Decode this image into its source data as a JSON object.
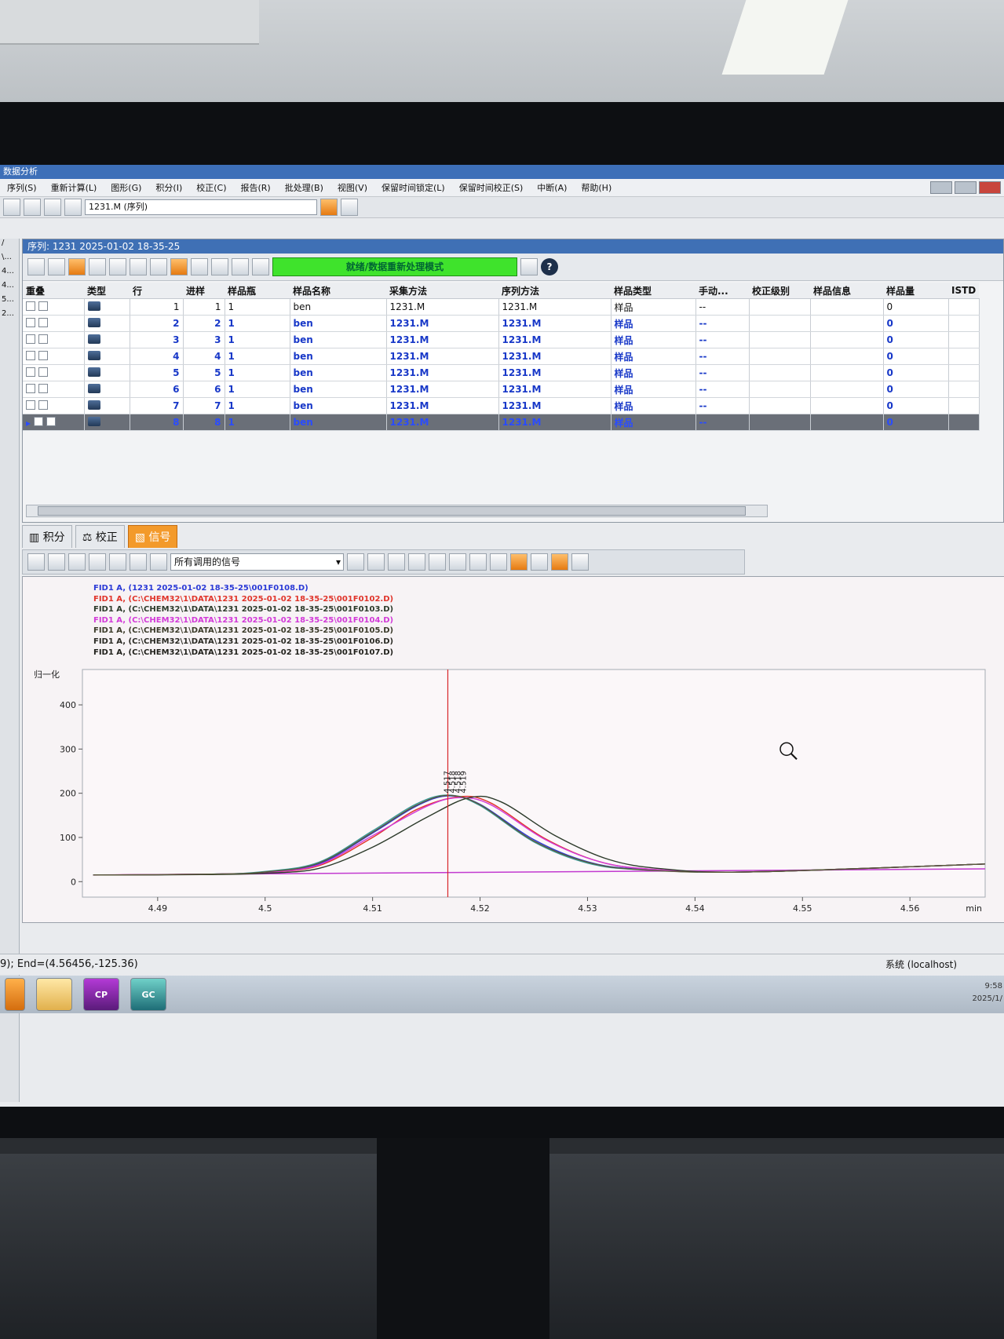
{
  "app": {
    "title": "数据分析",
    "menu": [
      "序列(S)",
      "重新计算(L)",
      "图形(G)",
      "积分(I)",
      "校正(C)",
      "报告(R)",
      "批处理(B)",
      "视图(V)",
      "保留时间锁定(L)",
      "保留时间校正(S)",
      "中断(A)",
      "帮助(H)"
    ],
    "method_combo": "1231.M (序列)"
  },
  "sequence": {
    "title": "序列:  1231 2025-01-02 18-35-25",
    "status": "就绪/数据重新处理模式",
    "columns": [
      "重叠",
      "类型",
      "行",
      "进样",
      "样品瓶",
      "样品名称",
      "采集方法",
      "序列方法",
      "样品类型",
      "手动...",
      "校正级别",
      "样品信息",
      "样品量",
      "ISTD"
    ],
    "rows": [
      {
        "line": "1",
        "inj": "1",
        "vial": "1",
        "name": "ben",
        "acq": "1231.M",
        "seqm": "1231.M",
        "stype": "样品",
        "manual": "--",
        "amount": "0"
      },
      {
        "line": "2",
        "inj": "2",
        "vial": "1",
        "name": "ben",
        "acq": "1231.M",
        "seqm": "1231.M",
        "stype": "样品",
        "manual": "--",
        "amount": "0"
      },
      {
        "line": "3",
        "inj": "3",
        "vial": "1",
        "name": "ben",
        "acq": "1231.M",
        "seqm": "1231.M",
        "stype": "样品",
        "manual": "--",
        "amount": "0"
      },
      {
        "line": "4",
        "inj": "4",
        "vial": "1",
        "name": "ben",
        "acq": "1231.M",
        "seqm": "1231.M",
        "stype": "样品",
        "manual": "--",
        "amount": "0"
      },
      {
        "line": "5",
        "inj": "5",
        "vial": "1",
        "name": "ben",
        "acq": "1231.M",
        "seqm": "1231.M",
        "stype": "样品",
        "manual": "--",
        "amount": "0"
      },
      {
        "line": "6",
        "inj": "6",
        "vial": "1",
        "name": "ben",
        "acq": "1231.M",
        "seqm": "1231.M",
        "stype": "样品",
        "manual": "--",
        "amount": "0"
      },
      {
        "line": "7",
        "inj": "7",
        "vial": "1",
        "name": "ben",
        "acq": "1231.M",
        "seqm": "1231.M",
        "stype": "样品",
        "manual": "--",
        "amount": "0"
      },
      {
        "line": "8",
        "inj": "8",
        "vial": "1",
        "name": "ben",
        "acq": "1231.M",
        "seqm": "1231.M",
        "stype": "样品",
        "manual": "--",
        "amount": "0"
      }
    ]
  },
  "tabs": [
    "积分",
    "校正",
    "信号"
  ],
  "signal_combo": "所有调用的信号",
  "legend": [
    {
      "text": "FID1 A,  (1231 2025-01-02 18-35-25\\001F0108.D)",
      "color": "#2b3ad6"
    },
    {
      "text": "FID1 A,  (C:\\CHEM32\\1\\DATA\\1231 2025-01-02 18-35-25\\001F0102.D)",
      "color": "#e0342a"
    },
    {
      "text": "FID1 A,  (C:\\CHEM32\\1\\DATA\\1231 2025-01-02 18-35-25\\001F0103.D)",
      "color": "#2c3a2a"
    },
    {
      "text": "FID1 A,  (C:\\CHEM32\\1\\DATA\\1231 2025-01-02 18-35-25\\001F0104.D)",
      "color": "#d23ad8"
    },
    {
      "text": "FID1 A,  (C:\\CHEM32\\1\\DATA\\1231 2025-01-02 18-35-25\\001F0105.D)",
      "color": "#3b3b2a"
    },
    {
      "text": "FID1 A,  (C:\\CHEM32\\1\\DATA\\1231 2025-01-02 18-35-25\\001F0106.D)",
      "color": "#2a2a24"
    },
    {
      "text": "FID1 A,  (C:\\CHEM32\\1\\DATA\\1231 2025-01-02 18-35-25\\001F0107.D)",
      "color": "#1f1f1a"
    }
  ],
  "chart_data": {
    "type": "line",
    "ylabel": "归一化",
    "xlabel": "min",
    "xlim": [
      4.483,
      4.567
    ],
    "ylim": [
      -35,
      480
    ],
    "xticks": [
      "4.49",
      "4.5",
      "4.51",
      "4.52",
      "4.53",
      "4.54",
      "4.55",
      "4.56"
    ],
    "yticks": [
      "0",
      "100",
      "200",
      "300",
      "400"
    ],
    "cursor_x": 4.517,
    "peak_labels": [
      "4.517",
      "4.518",
      "4.518",
      "4.519"
    ],
    "series": [
      {
        "color": "#2b3ad6",
        "values": [
          [
            4.484,
            15
          ],
          [
            4.495,
            17
          ],
          [
            4.5,
            22
          ],
          [
            4.505,
            40
          ],
          [
            4.51,
            110
          ],
          [
            4.514,
            170
          ],
          [
            4.517,
            194
          ],
          [
            4.52,
            175
          ],
          [
            4.525,
            95
          ],
          [
            4.53,
            45
          ],
          [
            4.535,
            28
          ],
          [
            4.545,
            22
          ],
          [
            4.567,
            40
          ]
        ]
      },
      {
        "color": "#e0342a",
        "values": [
          [
            4.484,
            15
          ],
          [
            4.495,
            17
          ],
          [
            4.5,
            21
          ],
          [
            4.505,
            36
          ],
          [
            4.51,
            100
          ],
          [
            4.514,
            162
          ],
          [
            4.518,
            192
          ],
          [
            4.521,
            178
          ],
          [
            4.526,
            98
          ],
          [
            4.531,
            46
          ],
          [
            4.536,
            28
          ],
          [
            4.545,
            22
          ],
          [
            4.567,
            40
          ]
        ]
      },
      {
        "color": "#3a9a9a",
        "values": [
          [
            4.484,
            15
          ],
          [
            4.495,
            17
          ],
          [
            4.5,
            23
          ],
          [
            4.505,
            44
          ],
          [
            4.51,
            115
          ],
          [
            4.514,
            175
          ],
          [
            4.517,
            196
          ],
          [
            4.52,
            172
          ],
          [
            4.525,
            90
          ],
          [
            4.53,
            42
          ],
          [
            4.535,
            27
          ],
          [
            4.545,
            22
          ],
          [
            4.567,
            40
          ]
        ]
      },
      {
        "color": "#d23ad8",
        "values": [
          [
            4.484,
            15
          ],
          [
            4.495,
            17
          ],
          [
            4.5,
            21
          ],
          [
            4.505,
            38
          ],
          [
            4.51,
            104
          ],
          [
            4.515,
            170
          ],
          [
            4.518,
            190
          ],
          [
            4.521,
            174
          ],
          [
            4.526,
            96
          ],
          [
            4.531,
            46
          ],
          [
            4.536,
            28
          ],
          [
            4.545,
            22
          ],
          [
            4.567,
            40
          ]
        ]
      },
      {
        "color": "#2c3a2a",
        "values": [
          [
            4.484,
            15
          ],
          [
            4.495,
            16
          ],
          [
            4.5,
            19
          ],
          [
            4.505,
            30
          ],
          [
            4.51,
            78
          ],
          [
            4.515,
            145
          ],
          [
            4.519,
            190
          ],
          [
            4.522,
            180
          ],
          [
            4.527,
            104
          ],
          [
            4.532,
            50
          ],
          [
            4.537,
            29
          ],
          [
            4.545,
            22
          ],
          [
            4.567,
            40
          ]
        ]
      },
      {
        "color": "#5a5a3a",
        "values": [
          [
            4.484,
            15
          ],
          [
            4.495,
            17
          ],
          [
            4.5,
            22
          ],
          [
            4.505,
            42
          ],
          [
            4.51,
            112
          ],
          [
            4.514,
            172
          ],
          [
            4.517,
            195
          ],
          [
            4.52,
            174
          ],
          [
            4.525,
            92
          ],
          [
            4.53,
            44
          ],
          [
            4.535,
            27
          ],
          [
            4.545,
            22
          ],
          [
            4.567,
            40
          ]
        ]
      }
    ],
    "baseline": {
      "color": "#c23ad0",
      "values": [
        [
          4.484,
          15
        ],
        [
          4.567,
          29
        ]
      ]
    }
  },
  "statusline": {
    "left": "9); End=(4.56456,-125.36)",
    "right": "系统 (localhost)"
  },
  "tray": {
    "time": "9:58",
    "date": "2025/1/"
  },
  "taskbar": {
    "cp": "CP",
    "gc": "GC"
  }
}
